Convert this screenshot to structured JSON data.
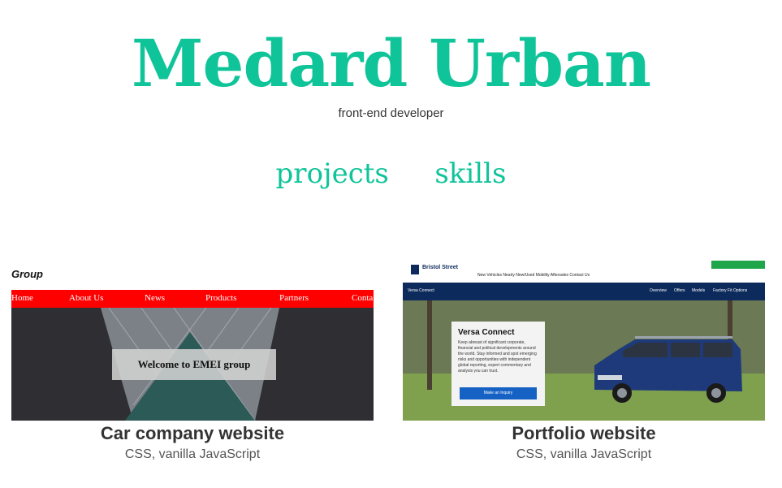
{
  "header": {
    "name": "Medard Urban",
    "role": "front-end developer"
  },
  "nav": {
    "items": [
      "projects",
      "skills"
    ]
  },
  "projects": [
    {
      "title": "Car company website",
      "tech": "CSS, vanilla JavaScript",
      "thumbnail": {
        "logo": "Group",
        "nav": [
          "Home",
          "About Us",
          "News",
          "Products",
          "Partners",
          "Conta"
        ],
        "welcome": "Welcome to EMEI group"
      }
    },
    {
      "title": "Portfolio website",
      "tech": "CSS, vanilla JavaScript",
      "thumbnail": {
        "logo": "Bristol Street",
        "top_links": "New Vehicles    Nearly New/Used    Mobility    Aftersales    Contact Us",
        "bar_left": "Versa Connect",
        "bar_links": [
          "Overview",
          "Offers",
          "Models",
          "Factory Fit Options"
        ],
        "box_title": "Versa Connect",
        "box_text": "Keep abreast of significant corporate, financial and political developments around the world. Stay informed and spot emerging risks and opportunities with independent global reporting, expert commentary and analysis you can trust.",
        "box_button": "Make an Inquiry"
      }
    }
  ],
  "colors": {
    "accent": "#10c49a",
    "thumb1_nav": "#ff0000",
    "thumb2_bar": "#0c2a5b",
    "thumb2_btn": "#1662c4"
  }
}
